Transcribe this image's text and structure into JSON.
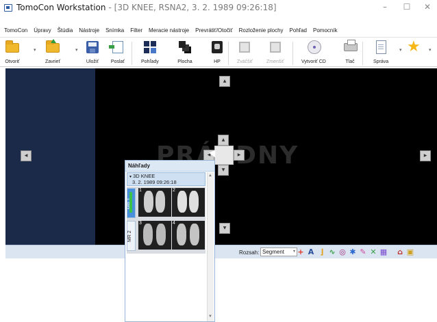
{
  "window": {
    "app_name": "TomoCon Workstation",
    "doc_title": "- [3D KNEE, RSNA2, 3. 2. 1989 09:26:18]",
    "minimize_glyph": "–",
    "maximize_glyph": "☐",
    "close_glyph": "✕"
  },
  "menu": [
    "TomoCon",
    "Úpravy",
    "Štúdia",
    "Nástroje",
    "Snímka",
    "Filter",
    "Meracie nástroje",
    "Prevrátiť/Otočiť",
    "Rozloženie plochy",
    "Pohľad",
    "Pomocník"
  ],
  "toolbar": {
    "open": "Otvoriť",
    "close": "Zavrieť",
    "save": "Uložiť",
    "send": "Poslať",
    "views": "Pohľady",
    "surface": "Plocha",
    "hp": "HP",
    "zoom_in": "Zväčšiť",
    "zoom_out": "Zmenšiť",
    "create_cd": "Vytvoriť CD",
    "print": "Tlač",
    "report": "Správa"
  },
  "viewer": {
    "watermark": "PRÁZDNY"
  },
  "thumbnails": {
    "title": "Náhľady",
    "study_name": "3D KNEE",
    "study_date": "3. 2. 1989 09:26:18",
    "series": [
      "MR 1",
      "MR 2"
    ],
    "image_numbers": [
      "1",
      "2",
      "3",
      "4"
    ]
  },
  "statusbar": {
    "range_label": "Rozsah:",
    "range_value": "Segment"
  },
  "colors": {
    "viewer_bg": "#000000",
    "left_panel": "#1a2a48",
    "statusbar": "#dbe5f1",
    "accent_green": "#3bc24a",
    "active_tab": "#4a8fda"
  }
}
